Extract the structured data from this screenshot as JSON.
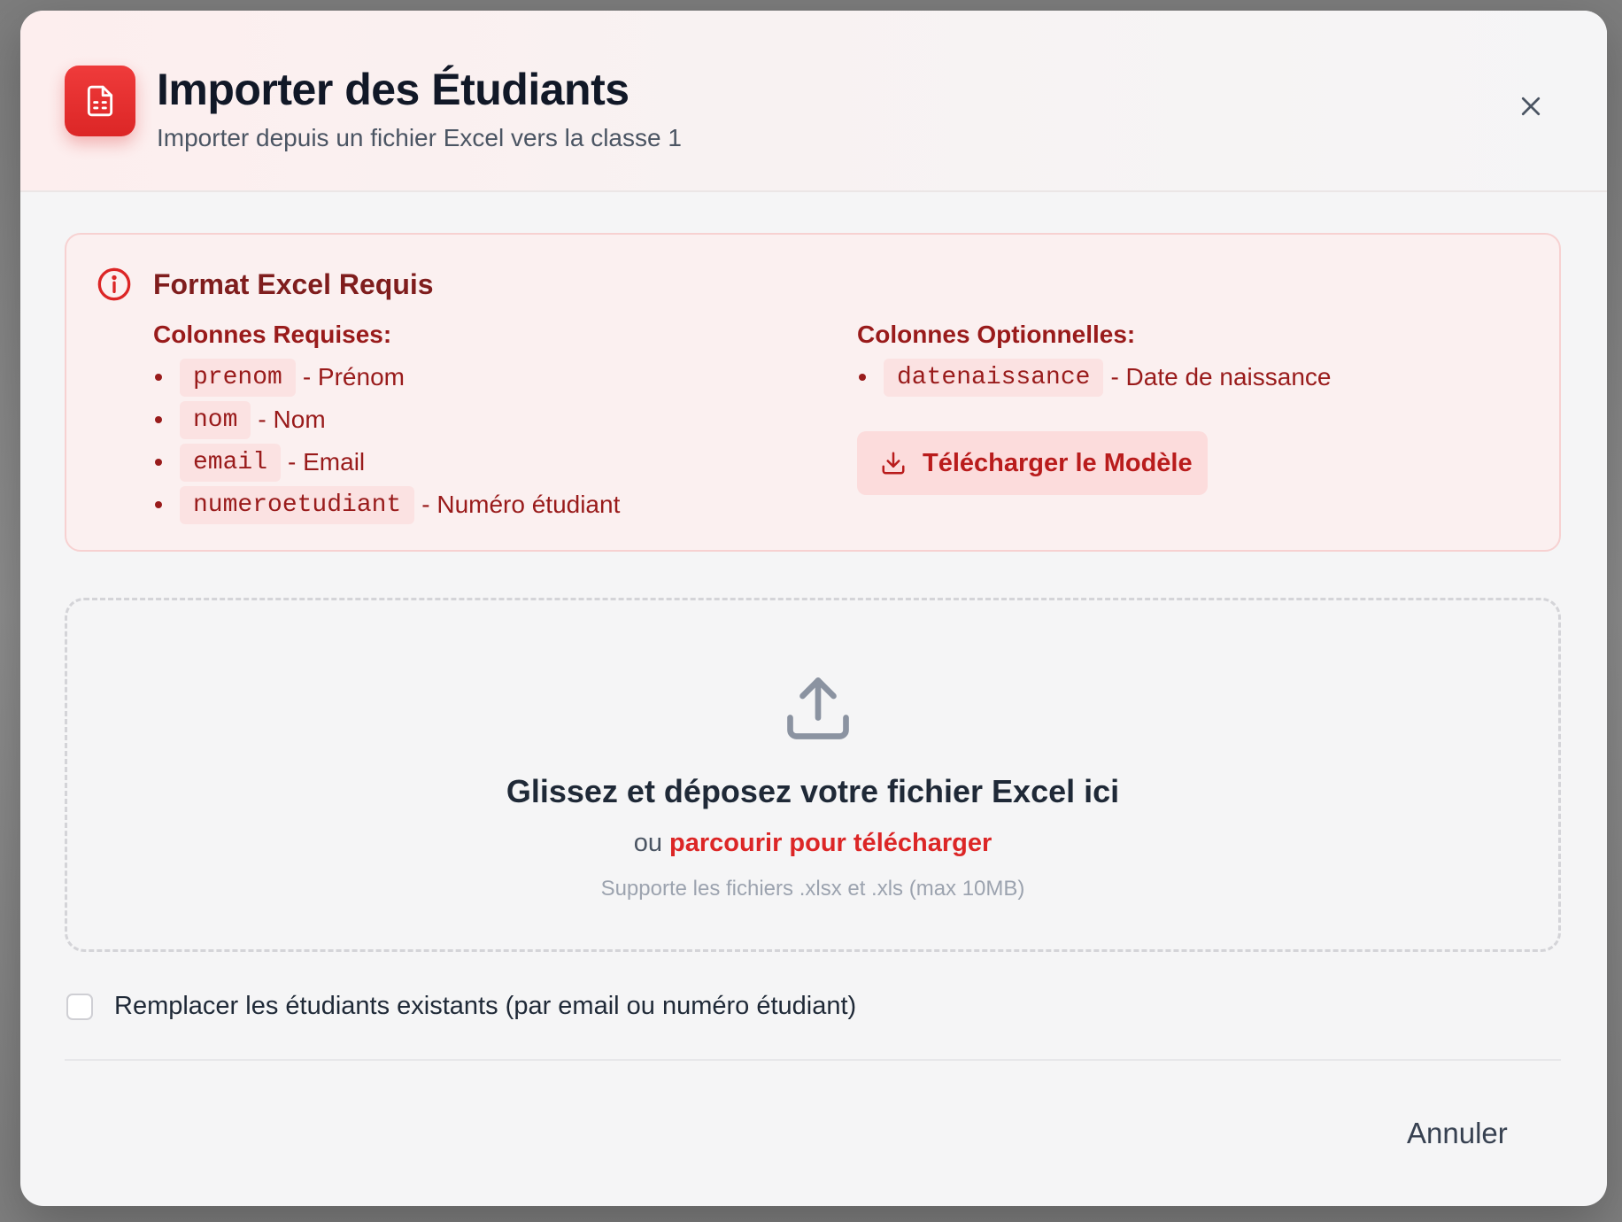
{
  "modal": {
    "title": "Importer des Étudiants",
    "subtitle": "Importer depuis un fichier Excel vers la classe 1",
    "accent_color": "#dc2626"
  },
  "format_box": {
    "title": "Format Excel Requis",
    "required": {
      "heading": "Colonnes Requises:",
      "columns": [
        {
          "code": "prenom",
          "desc": "- Prénom"
        },
        {
          "code": "nom",
          "desc": "- Nom"
        },
        {
          "code": "email",
          "desc": "- Email"
        },
        {
          "code": "numeroetudiant",
          "desc": "- Numéro étudiant"
        }
      ]
    },
    "optional": {
      "heading": "Colonnes Optionnelles:",
      "columns": [
        {
          "code": "datenaissance",
          "desc": "- Date de naissance"
        }
      ]
    },
    "download_label": "Télécharger le Modèle"
  },
  "dropzone": {
    "title": "Glissez et déposez votre fichier Excel ici",
    "or_text": "ou",
    "browse_label": "parcourir pour télécharger",
    "support_text": "Supporte les fichiers .xlsx et .xls (max 10MB)"
  },
  "options": {
    "replace_label": "Remplacer les étudiants existants (par email ou numéro étudiant)",
    "replace_checked": false
  },
  "footer": {
    "cancel_label": "Annuler"
  },
  "icons": {
    "header": "spreadsheet-file-icon",
    "close": "close-icon",
    "info": "info-circle-icon",
    "download": "download-icon",
    "upload": "upload-icon"
  }
}
